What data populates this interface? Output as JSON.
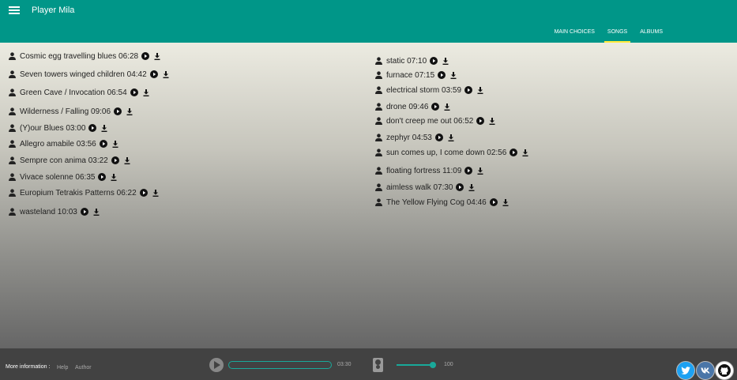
{
  "app": {
    "title": "Player Mila"
  },
  "tabs": [
    {
      "label": "MAIN CHOICES"
    },
    {
      "label": "SONGS",
      "active": true
    },
    {
      "label": "ALBUMS"
    }
  ],
  "songs_left": [
    {
      "text": "Cosmic egg travelling blues 06:28"
    },
    {
      "text": "Seven towers winged children 04:42"
    },
    {
      "text": "Green Cave / Invocation 06:54"
    },
    {
      "text": "Wilderness / Falling 09:06"
    },
    {
      "text": "(Y)our Blues 03:00"
    },
    {
      "text": "Allegro amabile 03:56"
    },
    {
      "text": "Sempre con anima 03:22"
    },
    {
      "text": "Vivace solenne 06:35"
    },
    {
      "text": "Europium Tetrakis Patterns 06:22"
    },
    {
      "text": "wasteland 10:03"
    }
  ],
  "songs_right": [
    {
      "text": "static 07:10"
    },
    {
      "text": "furnace 07:15"
    },
    {
      "text": "electrical storm 03:59"
    },
    {
      "text": "drone 09:46"
    },
    {
      "text": "don't creep me out 06:52"
    },
    {
      "text": "zephyr 04:53"
    },
    {
      "text": "sun comes up, I come down 02:56"
    },
    {
      "text": "floating fortress 11:09"
    },
    {
      "text": "aimless walk 07:30"
    },
    {
      "text": "The Yellow Flying Cog 04:46"
    }
  ],
  "footer": {
    "more_info": "More information :",
    "help": "Help",
    "author": "Author",
    "time": "03:30",
    "volume": "100",
    "volume_fraction": 0.9
  },
  "icons": {
    "menu": "menu-icon",
    "song": "person-icon",
    "play": "play-circle-icon",
    "download": "download-icon",
    "speaker": "speaker-icon",
    "social": [
      "twitter-icon",
      "vk-icon",
      "github-icon"
    ]
  },
  "colors": {
    "primary": "#009688",
    "tab_indicator": "#ffeb3b",
    "footer": "#424242",
    "accent": "#19a99a",
    "twitter": "#1da1f2",
    "vk": "#4a76a8",
    "github": "#ffffff"
  }
}
